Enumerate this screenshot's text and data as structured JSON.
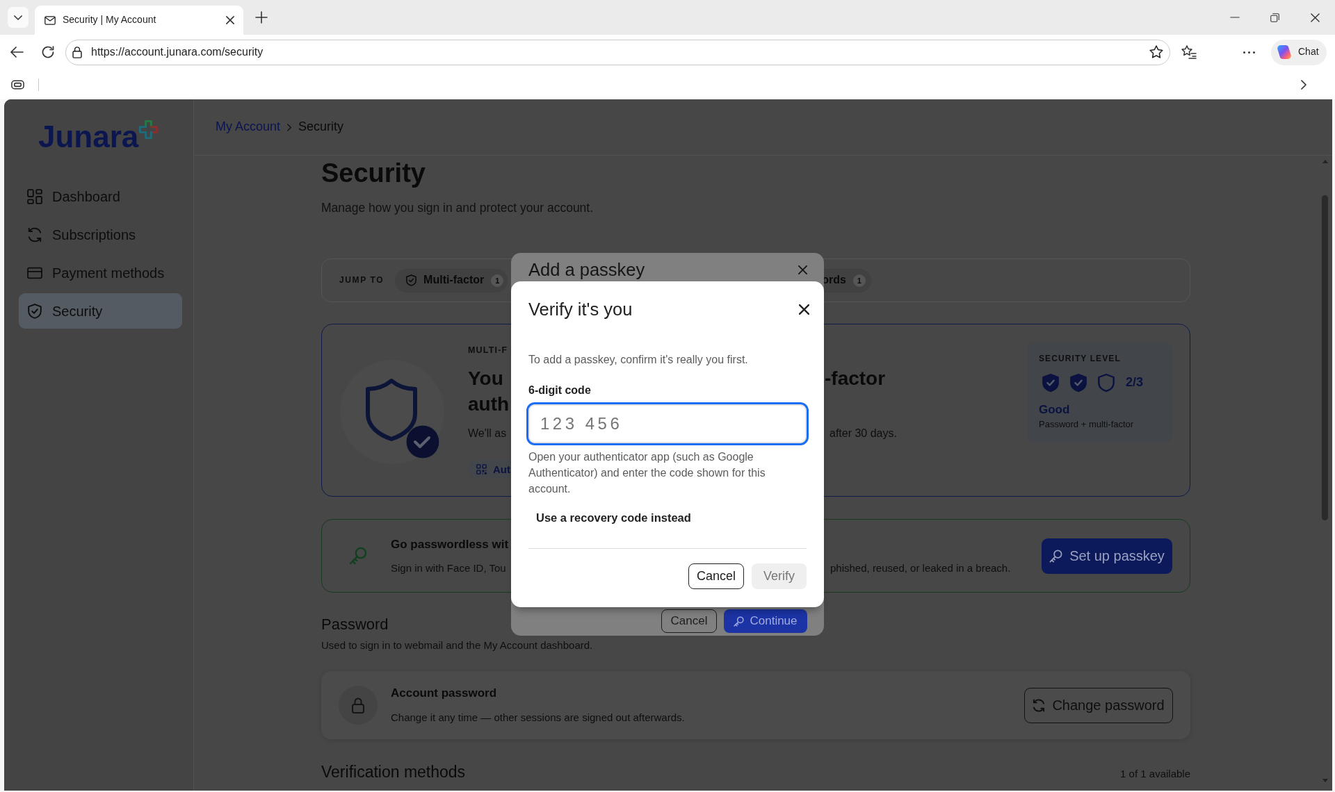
{
  "browser": {
    "tab_title": "Security | My Account",
    "url": "https://account.junara.com/security",
    "chat_label": "Chat"
  },
  "sidebar": {
    "logo": "Junara",
    "items": [
      {
        "label": "Dashboard",
        "selected": false
      },
      {
        "label": "Subscriptions",
        "selected": false
      },
      {
        "label": "Payment methods",
        "selected": false
      },
      {
        "label": "Security",
        "selected": true
      }
    ]
  },
  "breadcrumb": [
    {
      "kind": "link",
      "label": "My Account"
    },
    {
      "kind": "current",
      "label": "Security"
    }
  ],
  "page": {
    "title": "Security",
    "subtitle": "Manage how you sign in and protect your account."
  },
  "jump_bar": {
    "label": "JUMP TO",
    "chips": [
      {
        "kind": "shield",
        "label": "Multi-factor",
        "count": "1"
      },
      {
        "kind": "plain",
        "label": "ords",
        "count": "1"
      }
    ]
  },
  "mfa_card": {
    "eyebrow": "MULTI-F",
    "heading_lines": [
      {
        "left": "You",
        "right": "-factor"
      },
      {
        "left": "auth"
      }
    ],
    "body": {
      "left": "We'll as",
      "right": "after 30 days."
    },
    "chip": "Aut",
    "security_level": {
      "label": "SECURITY LEVEL",
      "shields": [
        {
          "filled": true
        },
        {
          "filled": true
        },
        {
          "filled": false
        }
      ],
      "score": "2/3",
      "rating": "Good",
      "detail": "Password + multi-factor"
    }
  },
  "passkey_card": {
    "title": "Go passwordless wit",
    "text_left": "Sign in with Face ID, Tou",
    "text_right": "phished, reused, or leaked in a breach.",
    "button": "Set up passkey"
  },
  "password_section": {
    "title": "Password",
    "subtitle": "Used to sign in to webmail and the My Account dashboard.",
    "item": {
      "title": "Account password",
      "text": "Change it any time — other sessions are signed out afterwards.",
      "button": "Change password"
    }
  },
  "verification_section": {
    "title": "Verification methods",
    "count": "1 of 1 available"
  },
  "passkey_dialog": {
    "title": "Add a passkey",
    "buttons": [
      {
        "kind": "outline",
        "label": "Cancel"
      },
      {
        "kind": "primary",
        "label": "Continue"
      }
    ]
  },
  "verify_dialog": {
    "title": "Verify it's you",
    "intro": "To add a passkey, confirm it's really you first.",
    "field": {
      "label": "6-digit code",
      "placeholder": "123 456",
      "focused": true
    },
    "help": "Open your authenticator app (such as Google Authenticator) and enter the code shown for this account.",
    "link": "Use a recovery code instead",
    "buttons": [
      {
        "kind": "outline",
        "label": "Cancel",
        "disabled": false
      },
      {
        "kind": "primary",
        "label": "Verify",
        "disabled": true
      }
    ]
  }
}
